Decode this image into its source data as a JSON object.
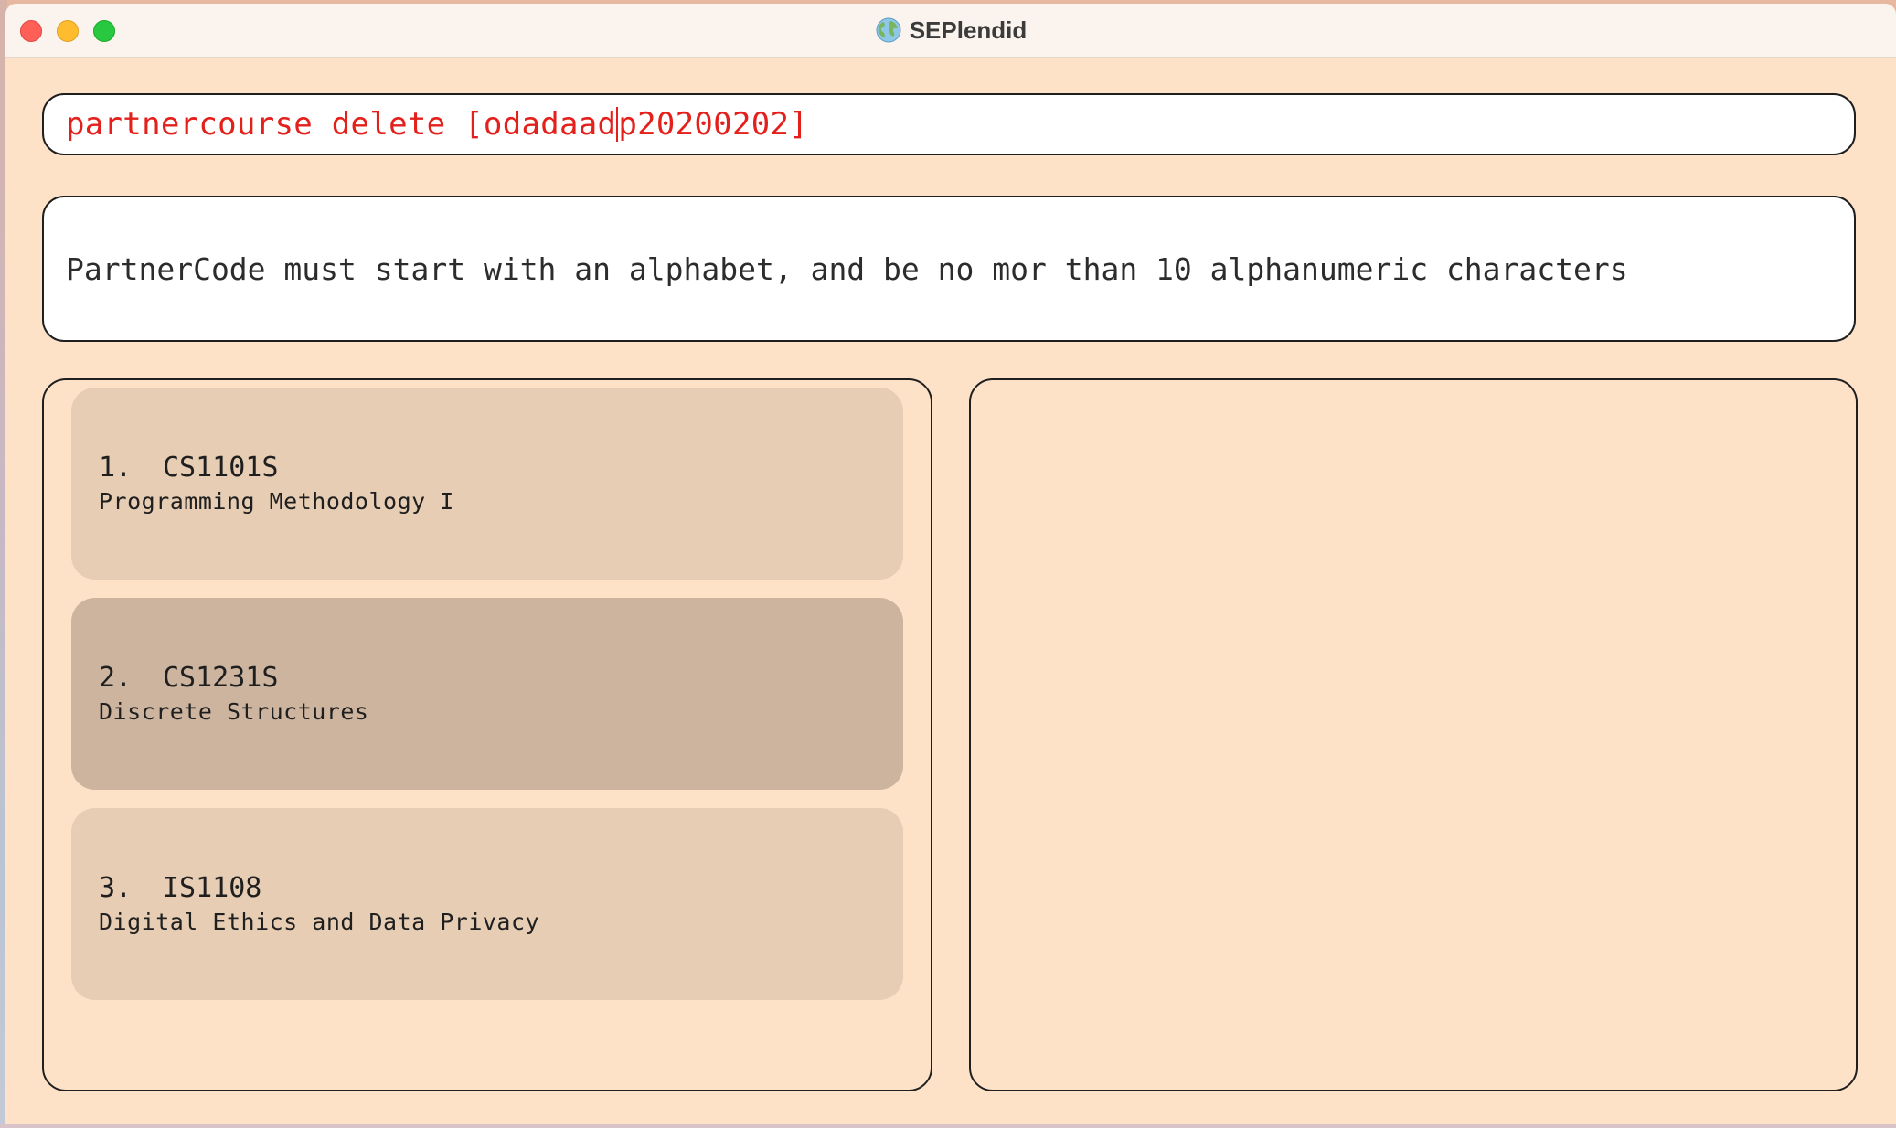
{
  "window": {
    "title": "SEPlendid",
    "icon": "globe-icon"
  },
  "command_box": {
    "value_before_caret": "partnercourse delete [odadaad",
    "value_after_caret": "p20200202]",
    "text_color": "#e3201b"
  },
  "result_display": {
    "message": "PartnerCode must start with an alphabet, and be no mor than 10 alphanumeric characters"
  },
  "course_list": {
    "items": [
      {
        "index": "1.",
        "code": "CS1101S",
        "name": "Programming Methodology I"
      },
      {
        "index": "2.",
        "code": "CS1231S",
        "name": "Discrete Structures"
      },
      {
        "index": "3.",
        "code": "IS1108",
        "name": "Digital Ethics and Data Privacy"
      }
    ]
  },
  "colors": {
    "window_background": "#fde2c8",
    "card_background": "#e6cdb4",
    "card_selected_background": "#cdb49f",
    "error_text": "#e3201b"
  }
}
